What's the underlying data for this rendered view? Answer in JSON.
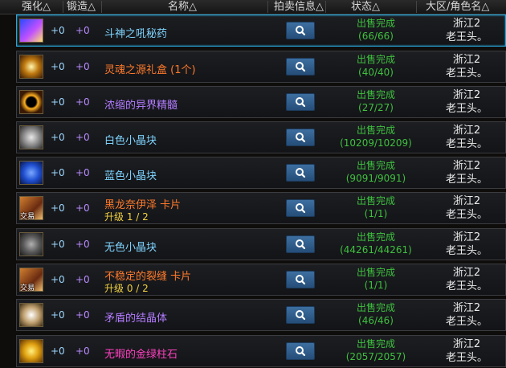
{
  "header": {
    "columns": [
      "强化△",
      "锻造△",
      "名称△",
      "拍卖信息△",
      "状态△",
      "大区/角色名△"
    ]
  },
  "rows": [
    {
      "reinforce": "+0",
      "forge": "+0",
      "name": "斗神之吼秘药",
      "name_color": "#7fd4ff",
      "upgrade": "",
      "icon_label": "",
      "status": "出售完成",
      "count": "(66/66)",
      "region": "浙江2",
      "role": "老王头。",
      "icon_bg": "linear-gradient(135deg,#2a4bff,#c050ff 55%,#ffe070)",
      "selected": true
    },
    {
      "reinforce": "+0",
      "forge": "+0",
      "name": "灵魂之源礼盒 (1个)",
      "name_color": "#ff7a2a",
      "upgrade": "",
      "icon_label": "",
      "status": "出售完成",
      "count": "(40/40)",
      "region": "浙江2",
      "role": "老王头。",
      "icon_bg": "radial-gradient(circle at 50% 50%,#fff6b0,#c07a10 45%,#3a1a05)",
      "selected": false
    },
    {
      "reinforce": "+0",
      "forge": "+0",
      "name": "浓缩的异界精髓",
      "name_color": "#b37cff",
      "upgrade": "",
      "icon_label": "",
      "status": "出售完成",
      "count": "(27/27)",
      "region": "浙江2",
      "role": "老王头。",
      "icon_bg": "radial-gradient(circle at 50% 50%,#000 30%,#ffb020 42%,#3a1a05 70%)",
      "selected": false
    },
    {
      "reinforce": "+0",
      "forge": "+0",
      "name": "白色小晶块",
      "name_color": "#7fd4ff",
      "upgrade": "",
      "icon_label": "",
      "status": "出售完成",
      "count": "(10209/10209)",
      "region": "浙江2",
      "role": "老王头。",
      "icon_bg": "radial-gradient(circle at 50% 50%,#e8e8e8,#8a8a8a 50%,#2a2a2a)",
      "selected": false
    },
    {
      "reinforce": "+0",
      "forge": "+0",
      "name": "蓝色小晶块",
      "name_color": "#7fd4ff",
      "upgrade": "",
      "icon_label": "",
      "status": "出售完成",
      "count": "(9091/9091)",
      "region": "浙江2",
      "role": "老王头。",
      "icon_bg": "radial-gradient(circle at 50% 50%,#7aa8ff,#1f4fd0 50%,#0a1540)",
      "selected": false
    },
    {
      "reinforce": "+0",
      "forge": "+0",
      "name": "黑龙奈伊泽  卡片",
      "name_color": "#ff7a2a",
      "upgrade": "升级 1 / 2",
      "icon_label": "交易",
      "status": "出售完成",
      "count": "(1/1)",
      "region": "浙江2",
      "role": "老王头。",
      "icon_bg": "linear-gradient(135deg,#d08030,#6a2a10 60%,#f0c070)",
      "selected": false
    },
    {
      "reinforce": "+0",
      "forge": "+0",
      "name": "无色小晶块",
      "name_color": "#7fd4ff",
      "upgrade": "",
      "icon_label": "",
      "status": "出售完成",
      "count": "(44261/44261)",
      "region": "浙江2",
      "role": "老王头。",
      "icon_bg": "radial-gradient(circle at 50% 50%,#b0b0b0,#5a5a5a 50%,#1a1a1a)",
      "selected": false
    },
    {
      "reinforce": "+0",
      "forge": "+0",
      "name": "不稳定的裂缝  卡片",
      "name_color": "#ff7a2a",
      "upgrade": "升级 0 / 2",
      "icon_label": "交易",
      "status": "出售完成",
      "count": "(1/1)",
      "region": "浙江2",
      "role": "老王头。",
      "icon_bg": "linear-gradient(135deg,#d08030,#6a2a10 60%,#f0c070)",
      "selected": false
    },
    {
      "reinforce": "+0",
      "forge": "+0",
      "name": "矛盾的结晶体",
      "name_color": "#b37cff",
      "upgrade": "",
      "icon_label": "",
      "status": "出售完成",
      "count": "(46/46)",
      "region": "浙江2",
      "role": "老王头。",
      "icon_bg": "radial-gradient(circle at 50% 50%,#ffffff,#c0a070 50%,#3a2a10)",
      "selected": false
    },
    {
      "reinforce": "+0",
      "forge": "+0",
      "name": "无暇的金绿柱石",
      "name_color": "#ff40c0",
      "upgrade": "",
      "icon_label": "",
      "status": "出售完成",
      "count": "(2057/2057)",
      "region": "浙江2",
      "role": "老王头。",
      "icon_bg": "radial-gradient(circle at 50% 50%,#fff080,#e0a010 45%,#5a3005)",
      "selected": false
    }
  ],
  "colors": {
    "reinforce": "#9fd8ff",
    "forge": "#b98bff",
    "status": "#3fc03f",
    "selected_border": "#2aa6d8"
  }
}
